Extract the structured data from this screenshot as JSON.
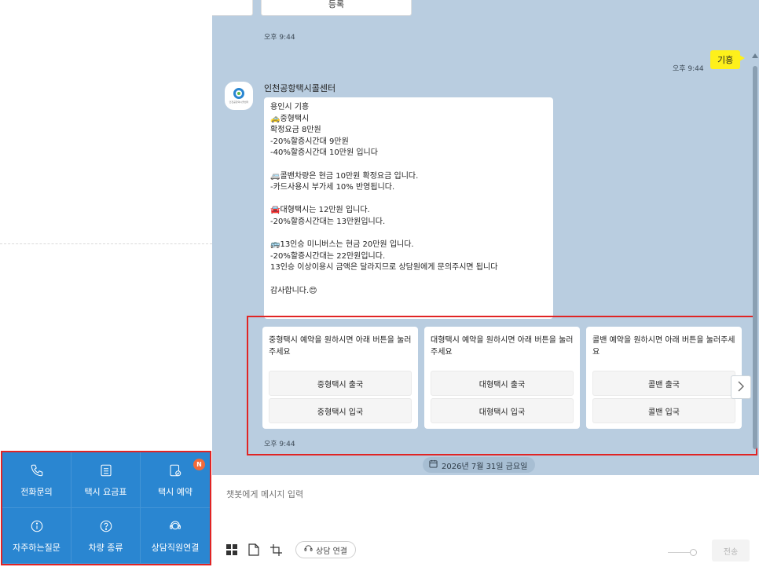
{
  "quick_menu": {
    "items": [
      {
        "icon": "phone-icon",
        "label": "전화문의"
      },
      {
        "icon": "fare-table-icon",
        "label": "택시 요금표"
      },
      {
        "icon": "reservation-icon",
        "label": "택시 예약"
      },
      {
        "icon": "info-icon",
        "label": "자주하는질문"
      },
      {
        "icon": "question-icon",
        "label": "차량 종류"
      },
      {
        "icon": "agent-icon",
        "label": "상담직원연결"
      }
    ],
    "badge": "N"
  },
  "chat": {
    "top_card_label": "등록",
    "top_time": "오후 9:44",
    "user_message": "기흥",
    "user_time": "오후 9:44",
    "sender": "인천공항택시콜센터",
    "avatar_text": "인천공항택시콜센터",
    "bot_message": "용인시 기흥\n🚕중형택시\n확정요금 8만원\n-20%할증시간대 9만원\n-40%할증시간대 10만원 입니다\n\n🚐콜밴차량은 현금 10만원 확정요금 입니다.\n-카드사용시 부가세 10% 반영됩니다.\n\n🚘대형택시는 12만원 입니다.\n-20%할증시간대는 13만원입니다.\n\n🚌13인승 미니버스는 현금 20만원 입니다.\n-20%할증시간대는 22만원입니다.\n13인승 이상이용시 금액은 달라지므로 상담원에게 문의주시면 됩니다\n\n감사합니다.😊",
    "cards": [
      {
        "desc": "중형택시 예약을 원하시면 아래 버튼을 눌러주세요",
        "buttons": [
          "중형택시 출국",
          "중형택시 입국"
        ]
      },
      {
        "desc": "대형택시 예약을 원하시면 아래 버튼을 눌러주세요",
        "buttons": [
          "대형택시 출국",
          "대형택시 입국"
        ]
      },
      {
        "desc": "콜밴 예약을 원하시면 아래 버튼을 눌러주세요",
        "buttons": [
          "콜밴 출국",
          "콜밴 입국"
        ]
      }
    ],
    "cards_time": "오후 9:44",
    "date_label": "2026년 7월 31일 금요일"
  },
  "input": {
    "placeholder": "챗봇에게 메시지 입력",
    "connect_label": "상담 연결",
    "send_label": "전송"
  },
  "colors": {
    "chat_bg": "#b9cde0",
    "quick_menu_bg": "#2a86d1",
    "user_bubble": "#fef01b",
    "highlight_outline": "#e02424"
  }
}
